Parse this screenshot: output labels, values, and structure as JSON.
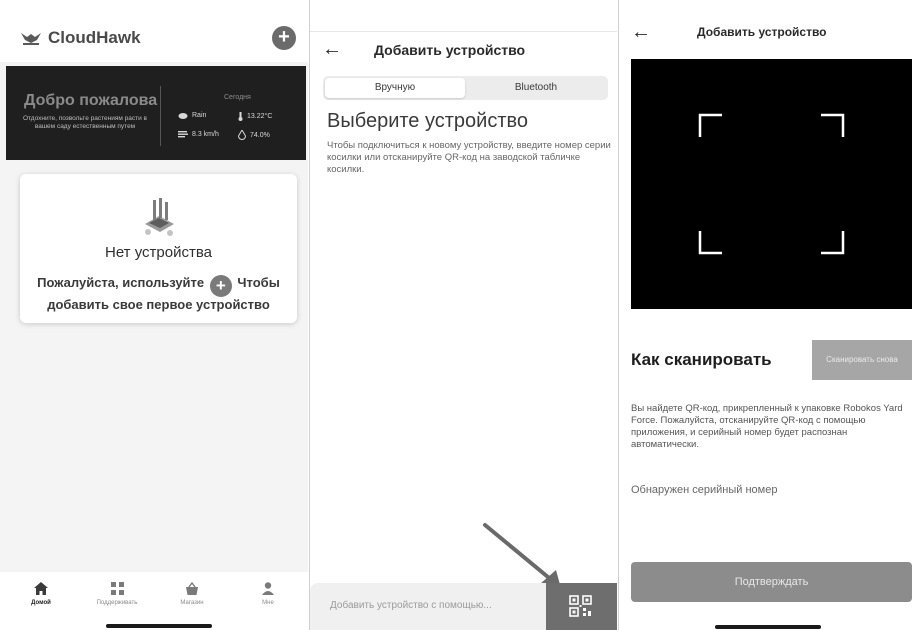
{
  "colors": {
    "dark_banner": "#1f1f1f",
    "button_gray": "#8c8c8c",
    "qr_button": "#6e6e6e"
  },
  "home": {
    "logo_text": "CloudHawk",
    "add_icon": "plus-circle-icon",
    "welcome": {
      "title": "Добро пожалова",
      "subtitle": "Отдохните, позвольте растениям расти в вашем саду естественным путем",
      "today_label": "Сегодня",
      "weather": {
        "condition": "Rain",
        "temperature": "13.22°C",
        "wind": "8.3 km/h",
        "humidity": "74.0%"
      }
    },
    "empty_card": {
      "title": "Нет устройства",
      "text_before": "Пожалуйста, используйте",
      "text_after": "Чтобы добавить свое первое устройство"
    },
    "tabs": [
      {
        "label": "Домой",
        "icon": "home-icon",
        "active": true
      },
      {
        "label": "Поддерживать",
        "icon": "grid-icon",
        "active": false
      },
      {
        "label": "Магазин",
        "icon": "shop-basket-icon",
        "active": false
      },
      {
        "label": "Мне",
        "icon": "person-icon",
        "active": false
      }
    ]
  },
  "add_device": {
    "title": "Добавить устройство",
    "segments": {
      "manual": "Вручную",
      "bluetooth": "Bluetooth"
    },
    "heading": "Выберите устройство",
    "description": "Чтобы подключиться к новому устройству, введите номер серии косилки или отсканируйте QR-код на заводской табличке косилки.",
    "input_placeholder": "Добавить устройство с помощью..."
  },
  "scan": {
    "title": "Добавить устройство",
    "heading": "Как сканировать",
    "rescan_button": "Сканировать снова",
    "description": "Вы найдете QR-код, прикрепленный к упаковке Robokos Yard Force. Пожалуйста, отсканируйте QR-код с помощью приложения, и серийный номер будет распознан автоматически.",
    "serial_label": "Обнаружен серийный номер",
    "confirm_button": "Подтверждать"
  }
}
